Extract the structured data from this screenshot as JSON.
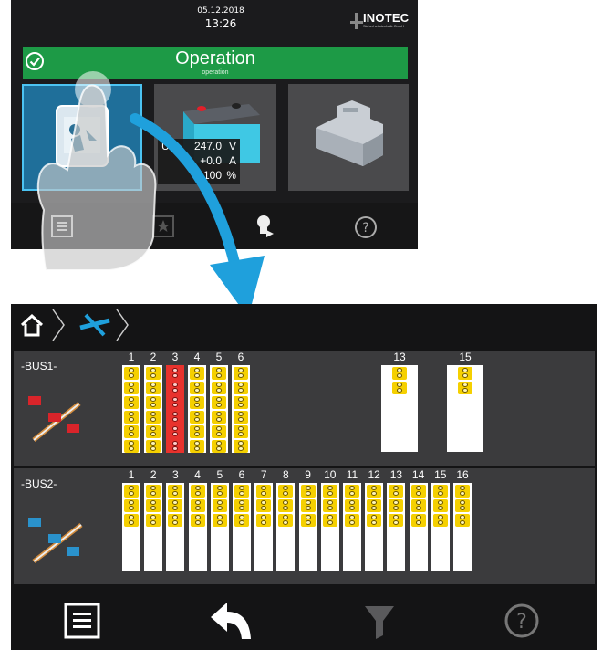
{
  "top_screen": {
    "date": "05.12.2018",
    "time": "13:26",
    "logo": {
      "name": "INOTEC",
      "sub": "Sicherheitstechnik GmbH"
    },
    "status": {
      "title": "Operation",
      "subtitle": "operation",
      "color": "#1d9a46"
    },
    "readout": {
      "u": {
        "label": "U",
        "value": "247.0",
        "unit": "V"
      },
      "i": {
        "value": "+0.0",
        "unit": "A"
      },
      "c": {
        "value": "100",
        "unit": "%"
      }
    },
    "toolbar_icons": [
      "list-icon",
      "star-icon",
      "lightbulb-arrow-icon",
      "help-icon"
    ]
  },
  "bottom_screen": {
    "breadcrumb_icons": [
      "home-icon",
      "bus-disabled-icon"
    ],
    "bus1": {
      "label": "-BUS1-",
      "slots": [
        {
          "num": "1",
          "cells": 6,
          "red": false,
          "white": 0
        },
        {
          "num": "2",
          "cells": 6,
          "red": false,
          "white": 0
        },
        {
          "num": "3",
          "cells": 6,
          "red": true,
          "white": 0
        },
        {
          "num": "4",
          "cells": 6,
          "red": false,
          "white": 0
        },
        {
          "num": "5",
          "cells": 6,
          "red": false,
          "white": 0
        },
        {
          "num": "6",
          "cells": 6,
          "red": false,
          "white": 0
        },
        {
          "num": "13",
          "cells": 2,
          "red": false,
          "white": 1
        },
        {
          "num": "15",
          "cells": 2,
          "red": false,
          "white": 1
        }
      ]
    },
    "bus2": {
      "label": "-BUS2-",
      "slots": [
        {
          "num": "1"
        },
        {
          "num": "2"
        },
        {
          "num": "3"
        },
        {
          "num": "4"
        },
        {
          "num": "5"
        },
        {
          "num": "6"
        },
        {
          "num": "7"
        },
        {
          "num": "8"
        },
        {
          "num": "9"
        },
        {
          "num": "10"
        },
        {
          "num": "11"
        },
        {
          "num": "12"
        },
        {
          "num": "13"
        },
        {
          "num": "14"
        },
        {
          "num": "15"
        },
        {
          "num": "16"
        }
      ]
    },
    "toolbar_icons": [
      "list-icon",
      "back-arrow-icon",
      "filter-icon",
      "help-icon"
    ]
  }
}
